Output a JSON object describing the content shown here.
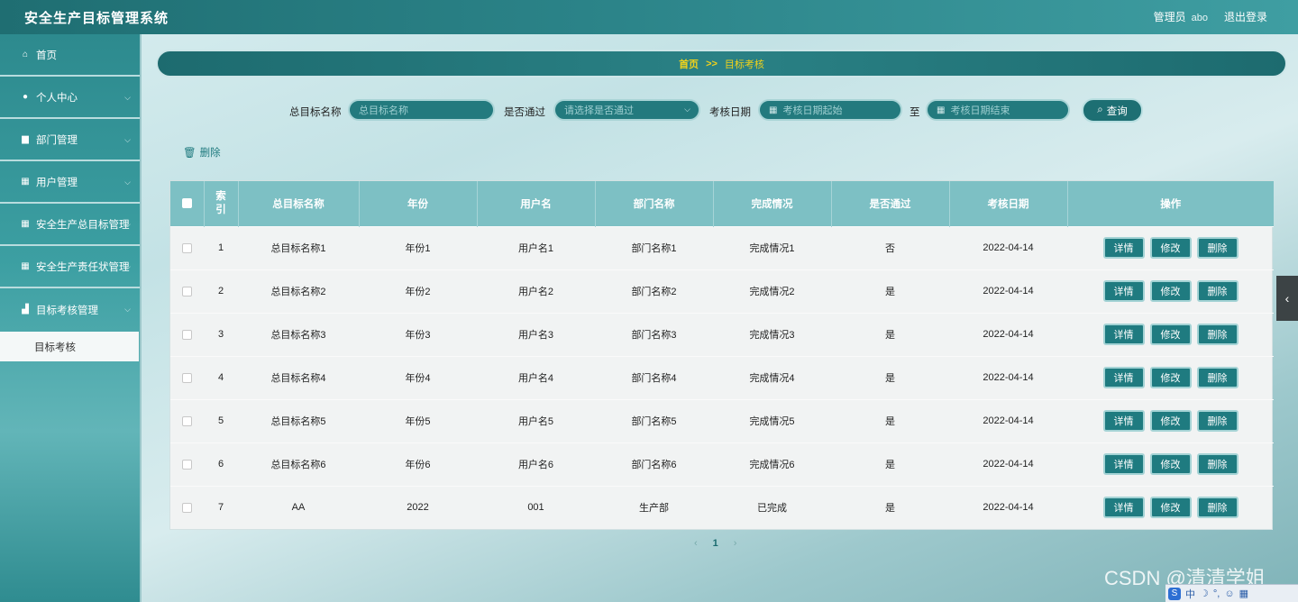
{
  "header": {
    "title": "安全生产目标管理系统",
    "role": "管理员",
    "username": "abo",
    "logout": "退出登录"
  },
  "sidebar": {
    "items": [
      {
        "label": "首页",
        "icon": "home-icon"
      },
      {
        "label": "个人中心",
        "icon": "user-icon"
      },
      {
        "label": "部门管理",
        "icon": "clipboard-icon"
      },
      {
        "label": "用户管理",
        "icon": "grid-icon"
      },
      {
        "label": "安全生产总目标管理",
        "icon": "grid-icon"
      },
      {
        "label": "安全生产责任状管理",
        "icon": "grid-icon"
      },
      {
        "label": "目标考核管理",
        "icon": "chart-icon"
      }
    ],
    "active_sub": "目标考核"
  },
  "breadcrumb": {
    "home": "首页",
    "separator": ">>",
    "current": "目标考核"
  },
  "search": {
    "goal_label": "总目标名称",
    "goal_placeholder": "总目标名称",
    "passed_label": "是否通过",
    "passed_placeholder": "请选择是否通过",
    "date_label": "考核日期",
    "date_start_placeholder": "考核日期起始",
    "to_label": "至",
    "date_end_placeholder": "考核日期结束",
    "button": "查询"
  },
  "toolbar": {
    "batch_delete": "删除"
  },
  "table": {
    "headers": {
      "index": "索引",
      "goal": "总目标名称",
      "year": "年份",
      "user": "用户名",
      "dept": "部门名称",
      "status": "完成情况",
      "passed": "是否通过",
      "date": "考核日期",
      "ops": "操作"
    },
    "ops": {
      "detail": "详情",
      "edit": "修改",
      "delete": "删除"
    },
    "rows": [
      {
        "index": "1",
        "goal": "总目标名称1",
        "year": "年份1",
        "user": "用户名1",
        "dept": "部门名称1",
        "status": "完成情况1",
        "passed": "否",
        "date": "2022-04-14"
      },
      {
        "index": "2",
        "goal": "总目标名称2",
        "year": "年份2",
        "user": "用户名2",
        "dept": "部门名称2",
        "status": "完成情况2",
        "passed": "是",
        "date": "2022-04-14"
      },
      {
        "index": "3",
        "goal": "总目标名称3",
        "year": "年份3",
        "user": "用户名3",
        "dept": "部门名称3",
        "status": "完成情况3",
        "passed": "是",
        "date": "2022-04-14"
      },
      {
        "index": "4",
        "goal": "总目标名称4",
        "year": "年份4",
        "user": "用户名4",
        "dept": "部门名称4",
        "status": "完成情况4",
        "passed": "是",
        "date": "2022-04-14"
      },
      {
        "index": "5",
        "goal": "总目标名称5",
        "year": "年份5",
        "user": "用户名5",
        "dept": "部门名称5",
        "status": "完成情况5",
        "passed": "是",
        "date": "2022-04-14"
      },
      {
        "index": "6",
        "goal": "总目标名称6",
        "year": "年份6",
        "user": "用户名6",
        "dept": "部门名称6",
        "status": "完成情况6",
        "passed": "是",
        "date": "2022-04-14"
      },
      {
        "index": "7",
        "goal": "AA",
        "year": "2022",
        "user": "001",
        "dept": "生产部",
        "status": "已完成",
        "passed": "是",
        "date": "2022-04-14"
      }
    ]
  },
  "pagination": {
    "prev": "‹",
    "current": "1",
    "next": "›"
  },
  "overlay": {
    "watermark": "CSDN @清清学姐",
    "ime": "中"
  },
  "colors": {
    "accent": "#1f7b80",
    "header_bar": "#2b8388",
    "breadcrumb_text": "#f2d21a",
    "table_header": "#7dc0c4"
  }
}
